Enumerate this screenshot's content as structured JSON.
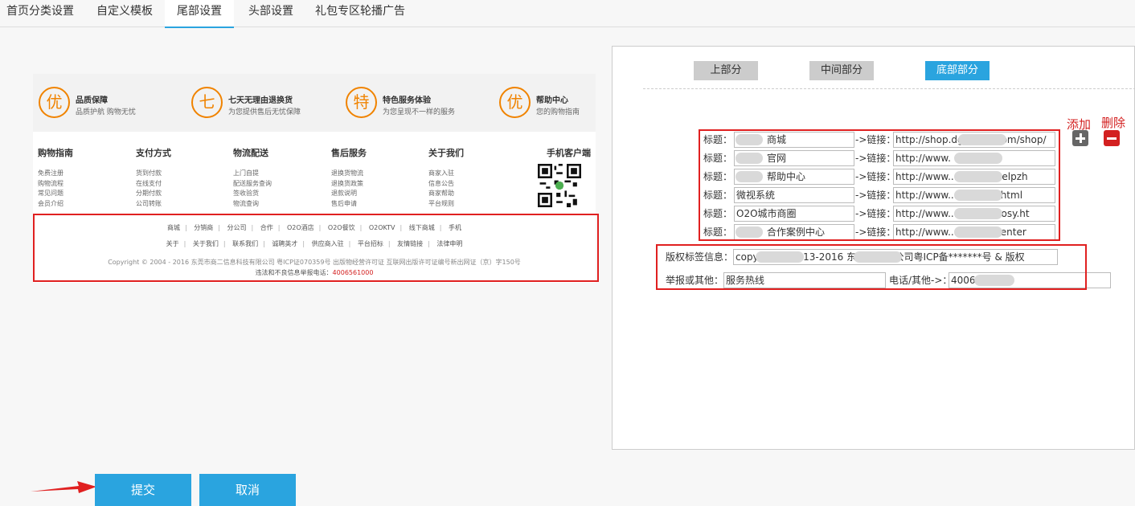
{
  "tabs": [
    {
      "label": "首页分类设置"
    },
    {
      "label": "自定义模板"
    },
    {
      "label": "尾部设置"
    },
    {
      "label": "头部设置"
    },
    {
      "label": "礼包专区轮播广告"
    }
  ],
  "preview": {
    "services": [
      {
        "icon": "优",
        "title": "品质保障",
        "sub": "品质护航 购物无忧"
      },
      {
        "icon": "七",
        "title": "七天无理由退换货",
        "sub": "为您提供售后无忧保障"
      },
      {
        "icon": "特",
        "title": "特色服务体验",
        "sub": "为您呈现不一样的服务"
      },
      {
        "icon": "优",
        "title": "帮助中心",
        "sub": "您的购物指南"
      }
    ],
    "columns": [
      {
        "title": "购物指南",
        "links": [
          "免费注册",
          "购物流程",
          "常见问题",
          "会员介绍"
        ]
      },
      {
        "title": "支付方式",
        "links": [
          "货到付款",
          "在线支付",
          "分期付款",
          "公司转账"
        ]
      },
      {
        "title": "物流配送",
        "links": [
          "上门自提",
          "配送服务查询",
          "签收验货",
          "物流查询"
        ]
      },
      {
        "title": "售后服务",
        "links": [
          "退换货物流",
          "退换货政策",
          "退款说明",
          "售后申请"
        ]
      },
      {
        "title": "关于我们",
        "links": [
          "商家入驻",
          "信息公告",
          "商家帮助",
          "平台规则"
        ]
      }
    ],
    "mobile_title": "手机客户端",
    "link_row1": [
      "商城",
      "分销商",
      "分公司",
      "合作",
      "O2O酒店",
      "O2O餐饮",
      "O2OKTV",
      "线下商城",
      "手机"
    ],
    "link_row2": [
      "关于",
      "关于我们",
      "联系我们",
      "诚聘英才",
      "供应商入驻",
      "平台招标",
      "友情链接",
      "法律申明"
    ],
    "copyright": "Copyright © 2004 - 2016 东莞市商二信息科技有限公司 粤ICP证070359号 出版物经营许可证 互联网出版许可证编号新出网证（京）字150号",
    "hotline_label": "违法和不良信息举报电话：",
    "hotline_phone": "4006561000"
  },
  "panel": {
    "subtabs": [
      {
        "label": "上部分"
      },
      {
        "label": "中间部分"
      },
      {
        "label": "底部部分"
      }
    ],
    "add_label": "添加",
    "delete_label": "删除",
    "title_label": "标题：",
    "link_label": "->链接：",
    "rows": [
      {
        "title": "商城",
        "link": "http://shop.dgs...ger.com/shop/"
      },
      {
        "title": "官网",
        "link": "http://www."
      },
      {
        "title": "帮助中心",
        "link": "http://www...cn/help/helpzh"
      },
      {
        "title": "微视系统",
        "link": "http://www...cn/Micro.html"
      },
      {
        "title": "O2O城市商圈",
        "link": "http://www...cn/cityo2osy.ht"
      },
      {
        "title": "合作案例中心",
        "link": "http://www...cn/caseCenter"
      }
    ],
    "copyright_label": "版权标签信息：",
    "copyright_value": "copyright@2013-2016 东莞市...限公司粤ICP备*******号 & 版权",
    "report_label": "举报或其他：",
    "report_value": "服务热线",
    "phone_label": "电话/其他->：",
    "phone_value": "4006"
  },
  "buttons": {
    "submit": "提交",
    "cancel": "取消"
  }
}
